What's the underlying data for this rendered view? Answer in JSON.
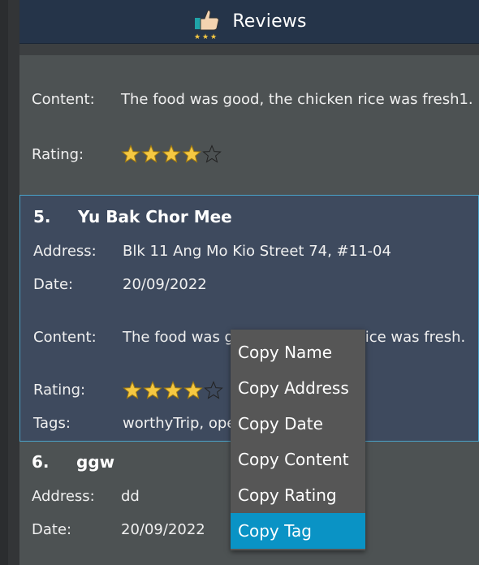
{
  "header": {
    "title": "Reviews",
    "icon": "thumbs-up-stars-icon"
  },
  "colors": {
    "selected_border": "#4aa3c9",
    "menu_highlight": "#0a93c5",
    "star_fill": "#f5c842"
  },
  "partial_card": {
    "content_label": "Content:",
    "content_value": "The food was good, the chicken rice was fresh1.",
    "rating_label": "Rating:",
    "rating": 4,
    "rating_max": 5
  },
  "selected_card": {
    "index": "5.",
    "name": "Yu Bak Chor Mee",
    "address_label": "Address:",
    "address_value": "Blk 11 Ang Mo Kio Street 74, #11-04",
    "date_label": "Date:",
    "date_value": "20/09/2022",
    "content_label": "Content:",
    "content_value": "The food was good, the chicken rice was fresh.",
    "rating_label": "Rating:",
    "rating": 4,
    "rating_max": 5,
    "tags_label": "Tags:",
    "tags_value": "worthyTrip, opened"
  },
  "card6": {
    "index": "6.",
    "name": "ggw",
    "address_label": "Address:",
    "address_value": "dd",
    "date_label": "Date:",
    "date_value": "20/09/2022"
  },
  "context_menu": {
    "items": [
      "Copy Name",
      "Copy Address",
      "Copy Date",
      "Copy Content",
      "Copy Rating",
      "Copy Tag"
    ],
    "active_index": 5
  }
}
